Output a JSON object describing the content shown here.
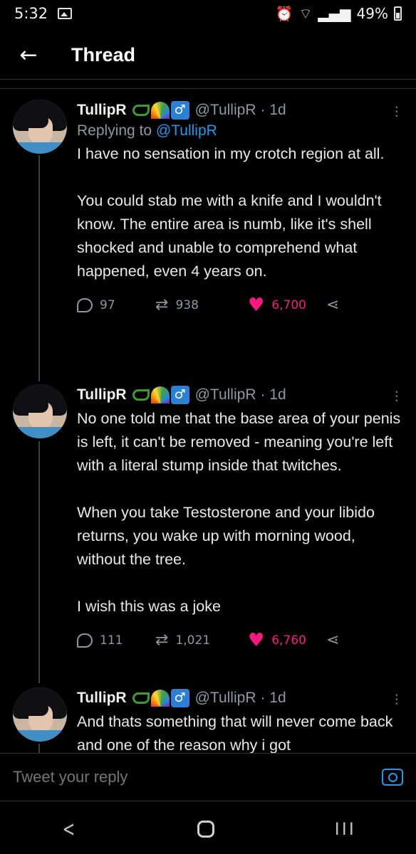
{
  "status_bar": {
    "time": "5:32",
    "battery": "49%"
  },
  "header": {
    "back_icon": "arrow-left-icon",
    "title": "Thread"
  },
  "tweets": [
    {
      "name": "TullipR",
      "handle": "@TullipR",
      "age": "· 1d",
      "replying_prefix": "Replying to ",
      "replying_handle": "@TullipR",
      "text": "I have no sensation in my crotch region at all.\n\nYou could stab me with a knife and I wouldn't know. The entire area is numb, like it's shell shocked and unable to comprehend what happened, even 4 years on.",
      "replies": "97",
      "retweets": "938",
      "likes": "6,700"
    },
    {
      "name": "TullipR",
      "handle": "@TullipR",
      "age": "· 1d",
      "text": "No one told me that the base area of your penis is left, it can't be removed - meaning you're left with a literal stump inside that twitches.\n\nWhen you take Testosterone and your libido returns, you wake up with morning wood, without the tree.\n\nI wish this was a joke",
      "replies": "111",
      "retweets": "1,021",
      "likes": "6,760"
    },
    {
      "name": "TullipR",
      "handle": "@TullipR",
      "age": "· 1d",
      "text": "And thats something that will never come back and one of the reason why i got"
    }
  ],
  "reply_bar": {
    "placeholder": "Tweet your reply"
  },
  "nav": {
    "back": "<",
    "recent": "III"
  },
  "colors": {
    "accent": "#1d9bf0",
    "like": "#f91880",
    "background": "#000000"
  }
}
